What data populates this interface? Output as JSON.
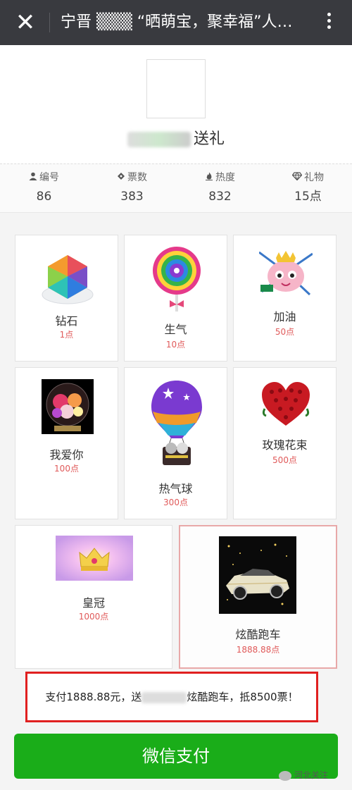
{
  "header": {
    "close_icon": "close-icon",
    "title": "宁晋 ▒▒▒ “晒萌宝，聚幸福”人…",
    "more_icon": "more-vertical-icon"
  },
  "profile": {
    "name_suffix": "送礼"
  },
  "stats": [
    {
      "icon": "person-icon",
      "label": "编号",
      "value": "86"
    },
    {
      "icon": "ticket-icon",
      "label": "票数",
      "value": "383"
    },
    {
      "icon": "flame-icon",
      "label": "热度",
      "value": "832"
    },
    {
      "icon": "diamond-icon",
      "label": "礼物",
      "value": "15点"
    }
  ],
  "gifts": [
    {
      "name": "钻石",
      "price": "1点"
    },
    {
      "name": "生气",
      "price": "10点"
    },
    {
      "name": "加油",
      "price": "50点"
    },
    {
      "name": "我爱你",
      "price": "100点"
    },
    {
      "name": "热气球",
      "price": "300点"
    },
    {
      "name": "玫瑰花束",
      "price": "500点"
    },
    {
      "name": "皇冠",
      "price": "1000点"
    },
    {
      "name": "炫酷跑车",
      "price": "1888.88点",
      "selected": true
    }
  ],
  "payment": {
    "summary_prefix": "支付1888.88元，送",
    "summary_suffix": "炫酷跑车，抵8500票！",
    "button_label": "微信支付"
  },
  "watermark": {
    "text": "河北关注"
  },
  "colors": {
    "topbar": "#393a3f",
    "pay_green": "#1aad19",
    "price_red": "#e05a5a",
    "highlight_red": "#e02020"
  }
}
